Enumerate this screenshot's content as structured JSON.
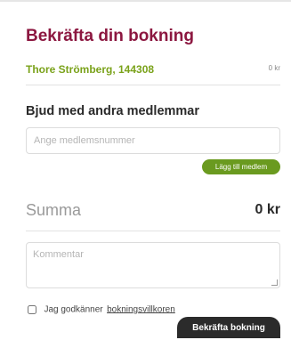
{
  "title": "Bekräfta din bokning",
  "member": {
    "name": "Thore Strömberg, 144308",
    "price": "0 kr"
  },
  "invite": {
    "heading": "Bjud med andra medlemmar",
    "placeholder": "Ange medlemsnummer",
    "value": "",
    "add_label": "Lägg till medlem"
  },
  "sum": {
    "label": "Summa",
    "value": "0 kr"
  },
  "comment": {
    "placeholder": "Kommentar",
    "value": ""
  },
  "terms": {
    "checked": false,
    "text": "Jag godkänner",
    "link": "bokningsvillkoren"
  },
  "confirm_label": "Bekräfta bokning",
  "colors": {
    "title": "#8c1740",
    "member": "#7aa21a",
    "add_button": "#6a9a1f",
    "confirm_button": "#2b2b2b"
  }
}
